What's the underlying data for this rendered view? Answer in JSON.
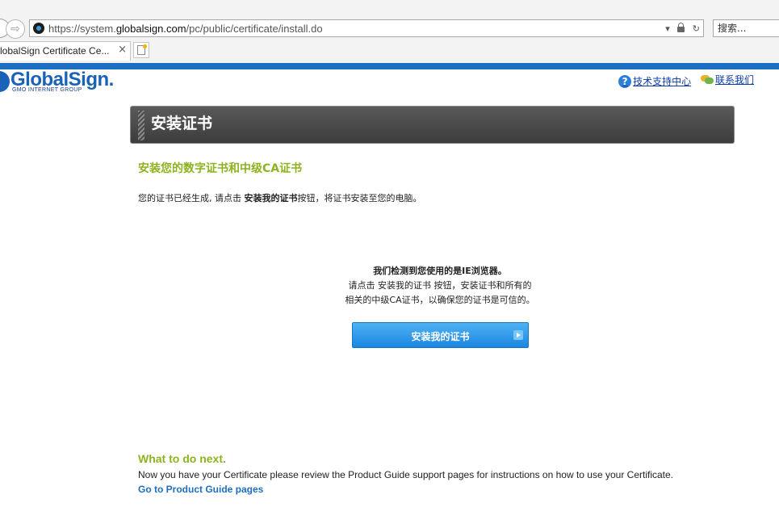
{
  "browser": {
    "url_prefix": "https://system.",
    "url_host": "globalsign.com",
    "url_path": "/pc/public/certificate/install.do",
    "search_placeholder": "搜索...",
    "tab_title": "lobalSign Certificate Ce...",
    "tab_close": "×",
    "forward_glyph": "⇨",
    "refresh_glyph": "↻",
    "dropdown_glyph": "▾"
  },
  "header": {
    "logo_text": "GlobalSign.",
    "logo_subtitle": "GMO INTERNET GROUP",
    "help_glyph": "?",
    "support_link": "技术支持中心",
    "contact_link": "联系我们"
  },
  "banner": {
    "title": "安装证书"
  },
  "main": {
    "section_title": "安装您的数字证书和中级CA证书",
    "intro_before": "您的证书已经生成, 请点击 ",
    "intro_bold": "安装我的证书",
    "intro_after": "按钮，将证书安装至您的电脑。",
    "ie_line1": "我们检测到您使用的是IE浏览器。",
    "ie_line2": "请点击 安装我的证书 按钮，安装证书和所有的",
    "ie_line3": "相关的中级CA证书，以确保您的证书是可信的。",
    "install_button": "安装我的证书"
  },
  "next": {
    "title": "What to do next.",
    "text": "Now you have your Certificate please review the Product Guide support pages for instructions on how to use your Certificate.",
    "link": "Go to Product Guide pages"
  },
  "colors": {
    "accent_green": "#8db320",
    "brand_blue": "#1a62b8",
    "button_blue": "#1b86e0",
    "link_blue": "#0a3ba8"
  }
}
